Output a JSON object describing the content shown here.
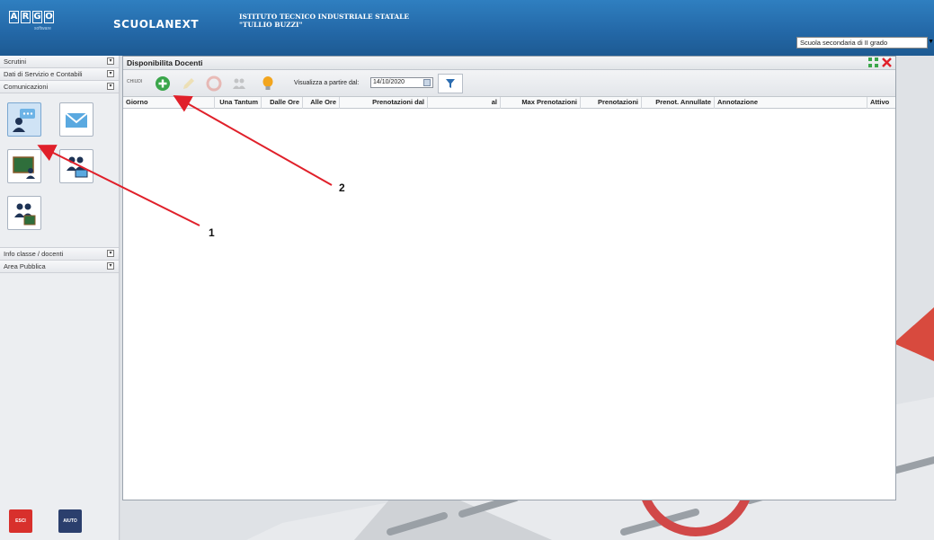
{
  "header": {
    "logo_letters": [
      "A",
      "R",
      "G",
      "O"
    ],
    "logo_sub": "software",
    "brand": "SCUOLANEXT",
    "institute_line1": "ISTITUTO TECNICO INDUSTRIALE STATALE",
    "institute_line2": "\"TULLIO BUZZI\"",
    "school_select": "Scuola secondaria di II grado"
  },
  "sidebar": {
    "items_top": [
      {
        "label": "Scrutini",
        "toggle": "▾"
      },
      {
        "label": "Dati di Servizio e Contabili",
        "toggle": "▾"
      },
      {
        "label": "Comunicazioni",
        "toggle": "▾"
      }
    ],
    "items_bottom": [
      {
        "label": "Info classe / docenti",
        "toggle": "▾"
      },
      {
        "label": "Area Pubblica",
        "toggle": "▾"
      }
    ],
    "tiles": [
      {
        "icon": "teacher-meeting-icon"
      },
      {
        "icon": "envelope-icon"
      },
      {
        "icon": "class-board-icon"
      },
      {
        "icon": "parents-screen-icon"
      },
      {
        "icon": "parents-board-icon"
      }
    ],
    "exit_label": "ESCI",
    "help_label": "AIUTO"
  },
  "panel": {
    "title": "Disponibilita Docenti",
    "toolbar": {
      "close_label": "CHIUDI",
      "date_label": "Visualizza a partire dal:",
      "date_value": "14/10/2020"
    },
    "columns": [
      "Giorno",
      "Una Tantum",
      "Dalle Ore",
      "Alle Ore",
      "Prenotazioni dal",
      "al",
      "Max Prenotazioni",
      "Prenotazioni",
      "Prenot. Annullate",
      "Annotazione",
      "Attivo"
    ]
  },
  "annotations": {
    "marker1": "1",
    "marker2": "2"
  },
  "colors": {
    "header_blue": "#2367a6",
    "add_green": "#3aa64a",
    "arrow_red": "#e0202a",
    "exit_red": "#d8302c",
    "help_navy": "#2b3f6d",
    "bulb_yellow": "#f2a51e"
  }
}
